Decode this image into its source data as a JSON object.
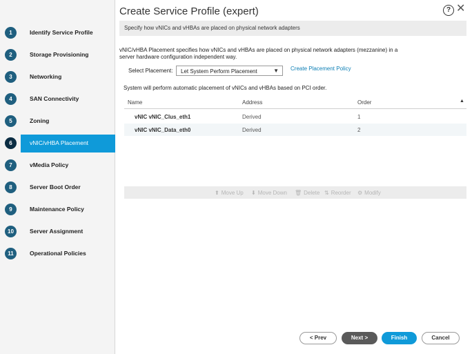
{
  "window": {
    "title": "Create Service Profile (expert)",
    "help_glyph": "?",
    "close_glyph": "✕"
  },
  "steps": [
    {
      "num": "1",
      "label": "Identify Service Profile",
      "active": false
    },
    {
      "num": "2",
      "label": "Storage Provisioning",
      "active": false
    },
    {
      "num": "3",
      "label": "Networking",
      "active": false
    },
    {
      "num": "4",
      "label": "SAN Connectivity",
      "active": false
    },
    {
      "num": "5",
      "label": "Zoning",
      "active": false
    },
    {
      "num": "6",
      "label": "vNIC/vHBA Placement",
      "active": true
    },
    {
      "num": "7",
      "label": "vMedia Policy",
      "active": false
    },
    {
      "num": "8",
      "label": "Server Boot Order",
      "active": false
    },
    {
      "num": "9",
      "label": "Maintenance Policy",
      "active": false
    },
    {
      "num": "10",
      "label": "Server Assignment",
      "active": false
    },
    {
      "num": "11",
      "label": "Operational Policies",
      "active": false
    }
  ],
  "main": {
    "banner": "Specify how vNICs and vHBAs are placed on physical network adapters",
    "description": "vNIC/vHBA Placement specifies how vNICs and vHBAs are placed on physical network adapters (mezzanine) in a server hardware configuration independent way.",
    "select_label": "Select Placement:",
    "select_value": "Let System Perform Placement",
    "create_link": "Create Placement Policy",
    "info": "System will perform automatic placement of vNICs and vHBAs based on PCI order."
  },
  "table": {
    "columns": [
      "Name",
      "Address",
      "Order"
    ],
    "rows": [
      {
        "name": "vNIC vNIC_Clus_eth1",
        "address": "Derived",
        "order": "1"
      },
      {
        "name": "vNIC vNIC_Data_eth0",
        "address": "Derived",
        "order": "2"
      }
    ],
    "toolbar": {
      "move_up": "Move Up",
      "move_down": "Move Down",
      "delete": "Delete",
      "reorder": "Reorder",
      "modify": "Modify"
    }
  },
  "footer": {
    "prev": "< Prev",
    "next": "Next >",
    "finish": "Finish",
    "cancel": "Cancel"
  },
  "colors": {
    "accent": "#0f9ad9",
    "rail": "#2a9fd6",
    "step_badge": "#1f5f7f"
  }
}
